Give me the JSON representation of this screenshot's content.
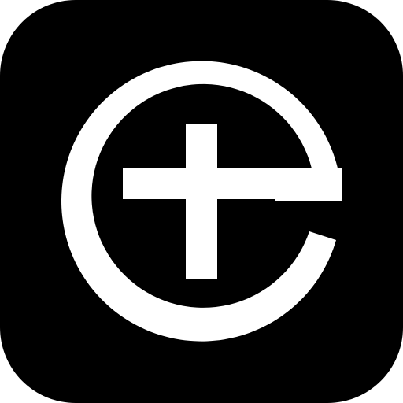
{
  "icon": {
    "name": "e-plus-logo-icon",
    "background_color": "#000000",
    "foreground_color": "#ffffff",
    "page_background": "#ffffff"
  }
}
